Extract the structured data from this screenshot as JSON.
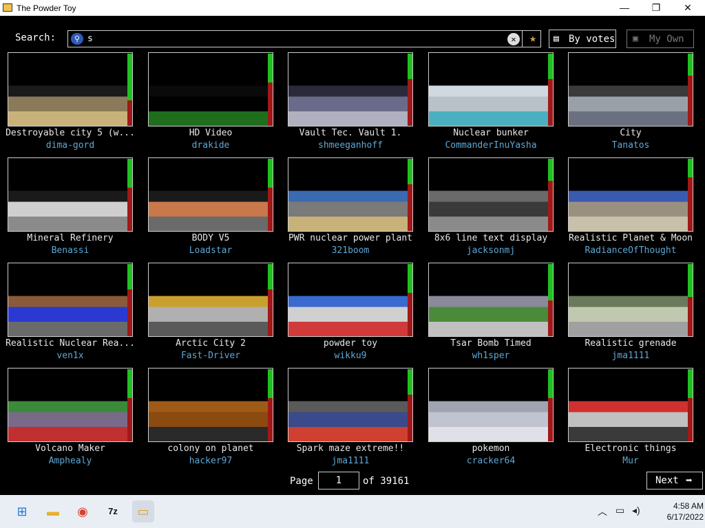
{
  "window": {
    "title": "The Powder Toy",
    "minimize": "—",
    "maximize": "❐",
    "close": "✕"
  },
  "search": {
    "label": "Search:",
    "query": "s",
    "icon": "search-icon",
    "clear_icon": "close-icon",
    "favorite_icon": "star-icon"
  },
  "sort_button": {
    "label": "By votes",
    "icon": "sort-icon"
  },
  "own_button": {
    "label": "My Own",
    "icon": "folder-icon"
  },
  "saves": [
    {
      "title": "Destroyable city 5 (w...",
      "author": "dima-gord",
      "score": 0.64,
      "palette": [
        "#8a7a5a",
        "#1a1a1a",
        "#c9b27a"
      ]
    },
    {
      "title": "HD Video",
      "author": "drakide",
      "score": 0.4,
      "palette": [
        "#000",
        "#0a0a0a",
        "#1e6e1e"
      ]
    },
    {
      "title": "Vault Tec. Vault 1.",
      "author": "shmeeganhoff",
      "score": 0.35,
      "palette": [
        "#6a6a8a",
        "#2a2a3a",
        "#b0b0c0"
      ]
    },
    {
      "title": "Nuclear bunker",
      "author": "CommanderInuYasha",
      "score": 0.35,
      "palette": [
        "#b8c0c8",
        "#d0d8e0",
        "#4ab0c0"
      ]
    },
    {
      "title": "City",
      "author": "Tanatos",
      "score": 0.3,
      "palette": [
        "#9aa0a8",
        "#3a3a3a",
        "#6a7080"
      ]
    },
    {
      "title": "Mineral Refinery",
      "author": "Benassi",
      "score": 0.4,
      "palette": [
        "#cfcfcf",
        "#1a1a1a",
        "#8a8a8a"
      ]
    },
    {
      "title": "BODY V5",
      "author": "Loadstar",
      "score": 0.4,
      "palette": [
        "#c8784a",
        "#1a1a1a",
        "#6a6a6a"
      ]
    },
    {
      "title": "PWR nuclear power plant",
      "author": "321boom",
      "score": 0.35,
      "palette": [
        "#7a7a7a",
        "#3a6ab0",
        "#c9b27a"
      ]
    },
    {
      "title": "8x6 line text display",
      "author": "jacksonmj",
      "score": 0.3,
      "palette": [
        "#3a3a3a",
        "#6a6a6a",
        "#8a8a8a"
      ]
    },
    {
      "title": "Realistic Planet & Moon",
      "author": "RadianceOfThought",
      "score": 0.25,
      "palette": [
        "#9a9080",
        "#3a5ab0",
        "#c8c0a8"
      ]
    },
    {
      "title": "Realistic Nuclear Rea...",
      "author": "ven1x",
      "score": 0.35,
      "palette": [
        "#2a3ad0",
        "#8a5a3a",
        "#6a6a6a"
      ]
    },
    {
      "title": "Arctic City 2",
      "author": "Fast-Driver",
      "score": 0.35,
      "palette": [
        "#b0b0b0",
        "#c9a030",
        "#5a5a5a"
      ]
    },
    {
      "title": "powder toy",
      "author": "wikku9",
      "score": 0.4,
      "palette": [
        "#d0d0d0",
        "#3a6ad0",
        "#d03a3a"
      ]
    },
    {
      "title": "Tsar Bomb Timed",
      "author": "wh1sper",
      "score": 0.5,
      "palette": [
        "#4a8a3a",
        "#8a8a9a",
        "#c0c0c0"
      ]
    },
    {
      "title": "Realistic grenade",
      "author": "jma1111",
      "score": 0.45,
      "palette": [
        "#c0c8b0",
        "#6a7a5a",
        "#a0a0a0"
      ]
    },
    {
      "title": "Volcano Maker",
      "author": "Amphealy",
      "score": 0.4,
      "palette": [
        "#7a6a8a",
        "#3a8a3a",
        "#c03030"
      ]
    },
    {
      "title": "colony on planet",
      "author": "hacker97",
      "score": 0.4,
      "palette": [
        "#8a4a10",
        "#a05a18",
        "#2a2a2a"
      ]
    },
    {
      "title": "Spark maze extreme!!",
      "author": "jma1111",
      "score": 0.35,
      "palette": [
        "#3a4a8a",
        "#5a5a5a",
        "#d04030"
      ]
    },
    {
      "title": "pokemon",
      "author": "cracker64",
      "score": 0.4,
      "palette": [
        "#c0c4d0",
        "#a0a4b0",
        "#e0e0e8"
      ]
    },
    {
      "title": "Electronic things",
      "author": "Mur",
      "score": 0.4,
      "palette": [
        "#c0c0c0",
        "#d03030",
        "#3a3a3a"
      ]
    }
  ],
  "pager": {
    "page_label": "Page",
    "page_value": "1",
    "of_label": "of 39161",
    "next_label": "Next",
    "next_icon": "arrow-right-icon"
  },
  "taskbar": {
    "icons": [
      "windows-start-icon",
      "file-explorer-icon",
      "chrome-icon",
      "7zip-icon",
      "powder-toy-icon"
    ],
    "tray_icons": [
      "chevron-up-icon",
      "network-icon",
      "volume-icon"
    ],
    "time": "4:58 AM",
    "date": "6/17/2022"
  }
}
